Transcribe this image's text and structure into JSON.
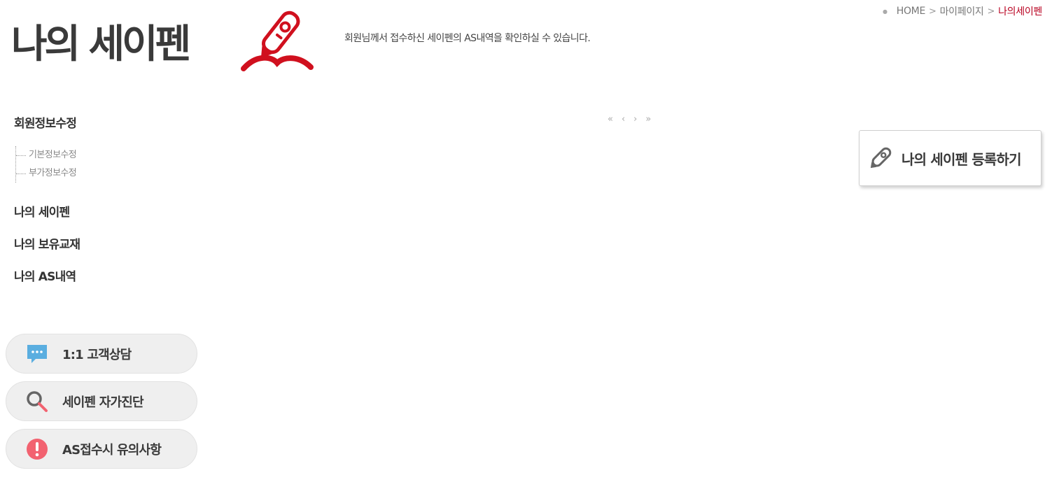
{
  "breadcrumb": {
    "home": "HOME",
    "mypage": "마이페이지",
    "current": "나의세이펜"
  },
  "header": {
    "title": "나의 세이펜",
    "description": "회원님께서 접수하신 세이펜의 AS내역을 확인하실 수 있습니다."
  },
  "nav": {
    "member_edit": "회원정보수정",
    "sub_items": [
      "기본정보수정",
      "부가정보수정"
    ],
    "my_saypen": "나의 세이펜",
    "my_books": "나의 보유교재",
    "my_as": "나의 AS내역"
  },
  "quick": {
    "consult": "1:1 고객상담",
    "diagnosis": "세이펜 자가진단",
    "as_notice": "AS접수시 유의사항"
  },
  "pagination": {
    "first": "«",
    "prev": "‹",
    "next": "›",
    "last": "»"
  },
  "register_button": "나의 세이펜 등록하기",
  "colors": {
    "accent": "#b8001f",
    "chat_icon": "#5aaee0",
    "alert_icon": "#f26270"
  }
}
